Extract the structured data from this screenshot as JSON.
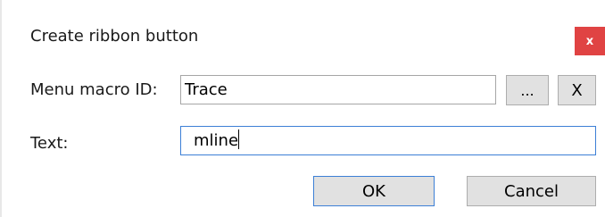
{
  "dialog": {
    "title": "Create ribbon button",
    "close_label": "x"
  },
  "form": {
    "macro_label": "Menu macro ID:",
    "macro_value": "Trace",
    "browse_label": "...",
    "clear_label": "X",
    "text_label": "Text:",
    "text_value": "mline"
  },
  "buttons": {
    "ok_label": "OK",
    "cancel_label": "Cancel"
  },
  "colors": {
    "close_bg": "#e04343",
    "focus_border": "#3c7fd6",
    "button_bg": "#e1e1e1"
  }
}
